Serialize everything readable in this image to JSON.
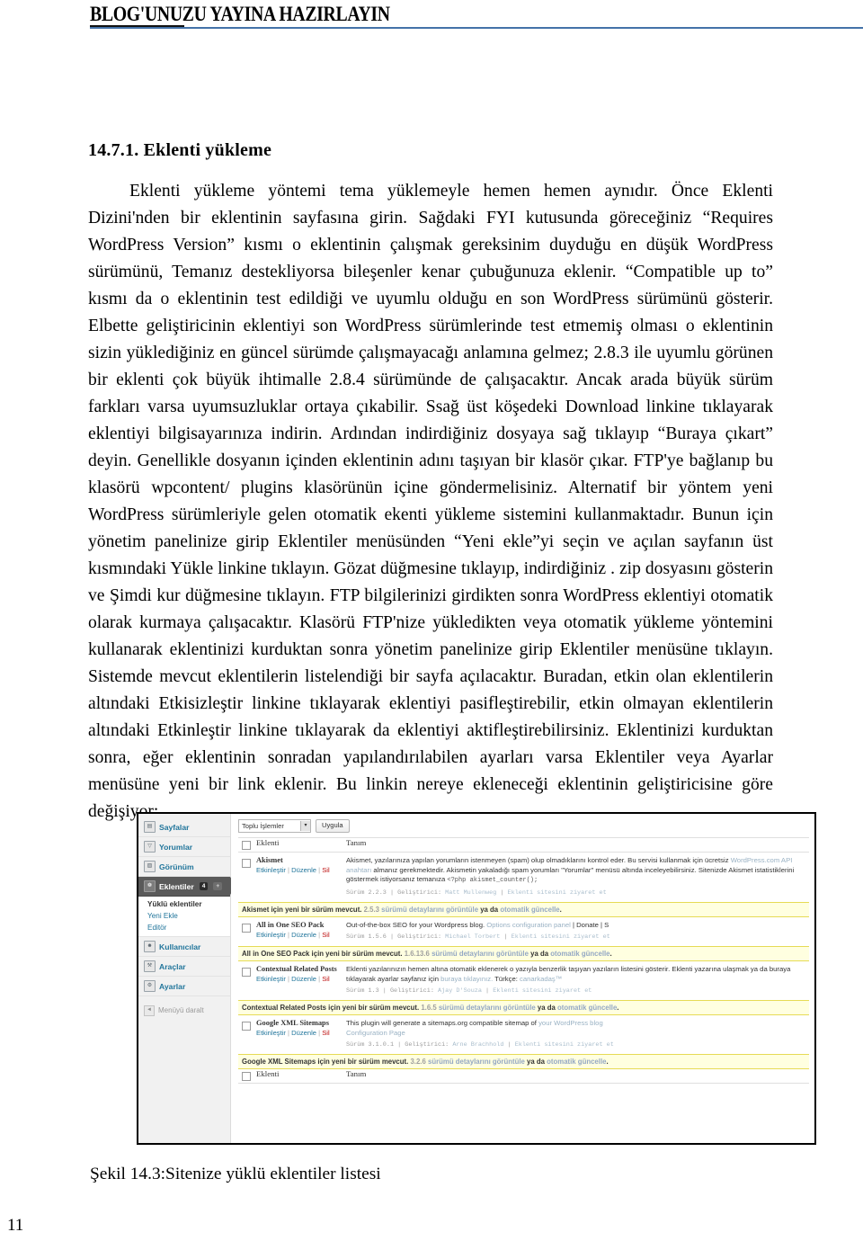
{
  "running_head": {
    "title": "BLOG'UNUZU YAYINA HAZIRLAYIN",
    "rule_color": "#4472a8"
  },
  "section": {
    "heading": "14.7.1. Eklenti yükleme",
    "body": "Eklenti yükleme yöntemi tema yüklemeyle hemen hemen aynıdır. Önce Eklenti Dizini'nden bir eklentinin sayfasına girin. Sağdaki FYI kutusunda göreceğiniz “Requires WordPress Version” kısmı o eklentinin çalışmak gereksinim duyduğu en düşük WordPress sürümünü, Temanız destekliyorsa bileşenler kenar çubuğunuza eklenir. “Compatible up to” kısmı da o eklentinin test edildiği ve uyumlu olduğu en son WordPress sürümünü gösterir. Elbette geliştiricinin eklentiyi son WordPress sürümlerinde test etmemiş olması o eklentinin sizin yüklediğiniz en güncel sürümde çalışmayacağı anlamına gelmez; 2.8.3 ile uyumlu görünen bir eklenti çok büyük ihtimalle 2.8.4 sürümünde de çalışacaktır. Ancak arada büyük sürüm farkları varsa uyumsuzluklar ortaya çıkabilir. Ssağ üst köşedeki Download linkine tıklayarak eklentiyi bilgisayarınıza indirin. Ardından indirdiğiniz dosyaya sağ tıklayıp “Buraya çıkart” deyin. Genellikle dosyanın içinden eklentinin adını taşıyan bir klasör çıkar. FTP'ye bağlanıp bu klasörü wpcontent/ plugins klasörünün içine göndermelisiniz. Alternatif bir yöntem yeni WordPress sürümleriyle gelen otomatik ekenti yükleme sistemini kullanmaktadır. Bunun için yönetim panelinize girip Eklentiler menüsünden “Yeni ekle”yi seçin ve açılan sayfanın üst kısmındaki Yükle linkine tıklayın. Gözat düğmesine tıklayıp, indirdiğiniz . zip dosyasını gösterin ve Şimdi kur düğmesine tıklayın. FTP bilgilerinizi girdikten sonra WordPress eklentiyi otomatik olarak kurmaya çalışacaktır. Klasörü FTP'nize yükledikten veya otomatik yükleme yöntemini kullanarak eklentinizi kurduktan sonra yönetim panelinize girip Eklentiler menüsüne tıklayın. Sistemde mevcut eklentilerin listelendiği bir sayfa açılacaktır. Buradan, etkin olan eklentilerin altındaki Etkisizleştir linkine tıklayarak eklentiyi pasifleştirebilir, etkin olmayan eklentilerin altındaki Etkinleştir linkine tıklayarak da eklentiyi aktifleştirebilirsiniz. Eklentinizi kurduktan sonra, eğer eklentinin sonradan yapılandırılabilen ayarları varsa Eklentiler veya Ayarlar menüsüne yeni bir link eklenir. Bu linkin nereye ekleneceği eklentinin geliştiricisine göre değişiyor;"
  },
  "figure": {
    "caption": "Şekil 14.3:Sitenize yüklü eklentiler listesi",
    "sidebar": {
      "items": [
        {
          "label": "Sayfalar",
          "icon": "page-icon",
          "glyph": "▤"
        },
        {
          "label": "Yorumlar",
          "icon": "comment-icon",
          "glyph": "▽"
        },
        {
          "label": "Görünüm",
          "icon": "appearance-icon",
          "glyph": "▨"
        }
      ],
      "active": {
        "label": "Eklentiler",
        "icon": "plugin-icon",
        "glyph": "❁",
        "badge": "4",
        "badge_plus": "+"
      },
      "submenu": [
        {
          "label": "Yüklü eklentiler",
          "current": true
        },
        {
          "label": "Yeni Ekle",
          "current": false
        },
        {
          "label": "Editör",
          "current": false
        }
      ],
      "items_after": [
        {
          "label": "Kullanıcılar",
          "icon": "users-icon",
          "glyph": "☻"
        },
        {
          "label": "Araçlar",
          "icon": "tools-icon",
          "glyph": "⚒"
        },
        {
          "label": "Ayarlar",
          "icon": "settings-icon",
          "glyph": "⚙"
        }
      ],
      "collapse": {
        "label": "Menüyü daralt",
        "glyph": "◄"
      }
    },
    "toolbar": {
      "bulk_select_value": "Toplu İşlemler",
      "bulk_select_arrow": "▾",
      "apply_button": "Uygula"
    },
    "table": {
      "headers": {
        "name": "Eklenti",
        "description": "Tanım"
      },
      "rows": [
        {
          "name": "Akismet",
          "actions": {
            "activate": "Etkinleştir",
            "edit": "Düzenle",
            "delete": "Sil"
          },
          "description_1": "Akismet, yazılarınıza yapılan yorumların istenmeyen (spam) olup olmadıklarını kontrol eder. Bu servisi kullanmak için ücretsiz ",
          "description_link": "WordPress.com API anahtarı",
          "description_2": " almanız gerekmektedir. Akismetin yakaladığı spam yorumları \"Yorumlar\" menüsü altında inceleyebilirsiniz. Sitenizde Akismet istatistiklerini göstermek istiyorsanız temanıza ",
          "description_code": "<?php akismet_counter();",
          "meta_version": "Sürüm 2.2.3",
          "meta_author_label": "Geliştirici:",
          "meta_author": "Matt Mullenweg",
          "meta_site": "Eklenti sitesini ziyaret et",
          "update_prefix": "Akismet için yeni bir sürüm mevcut.",
          "update_version": "2.5.3",
          "update_link1": "sürümü detaylarını görüntüle",
          "update_mid": "ya da",
          "update_link2": "otomatik güncelle",
          "update_suffix": "."
        },
        {
          "name": "All in One SEO Pack",
          "actions": {
            "activate": "Etkinleştir",
            "edit": "Düzenle",
            "delete": "Sil"
          },
          "description_1": "Out-of-the-box SEO for your Wordpress blog. ",
          "description_link": "Options configuration panel",
          "description_2": " | Donate | S",
          "description_code": "",
          "meta_version": "Sürüm 1.5.6",
          "meta_author_label": "Geliştirici:",
          "meta_author": "Michael Torbert",
          "meta_site": "Eklenti sitesini ziyaret et",
          "update_prefix": "All in One SEO Pack için yeni bir sürüm mevcut.",
          "update_version": "1.6.13.6",
          "update_link1": "sürümü detaylarını görüntüle",
          "update_mid": "ya da",
          "update_link2": "otomatik güncelle",
          "update_suffix": "."
        },
        {
          "name": "Contextual Related Posts",
          "actions": {
            "activate": "Etkinleştir",
            "edit": "Düzenle",
            "delete": "Sil"
          },
          "description_1": "Eklenti yazılarınızın hemen altına otomatik eklenerek o yazıyla benzerlik taşıyan yazıların listesini gösterir. Eklenti yazarına ulaşmak ya da buraya tıklayarak ayarlar sayfanız için ",
          "description_link": "buraya tıklayınız.",
          "description_2": " Türkçe: ",
          "description_code": "canarkadaş™",
          "meta_version": "Sürüm 1.3",
          "meta_author_label": "Geliştirici:",
          "meta_author": "Ajay D'Souza",
          "meta_site": "Eklenti sitesini ziyaret et",
          "update_prefix": "Contextual Related Posts için yeni bir sürüm mevcut.",
          "update_version": "1.6.5",
          "update_link1": "sürümü detaylarını görüntüle",
          "update_mid": "ya da",
          "update_link2": "otomatik güncelle",
          "update_suffix": "."
        },
        {
          "name": "Google XML  Sitemaps",
          "actions": {
            "activate": "Etkinleştir",
            "edit": "Düzenle",
            "delete": "Sil"
          },
          "description_1": "This plugin will generate a sitemaps.org compatible sitemap of ",
          "description_link": "your WordPress blog",
          "description_2": " ",
          "description_code": "Configuration Page",
          "meta_version": "Sürüm 3.1.0.1",
          "meta_author_label": "Geliştirici:",
          "meta_author": "Arne Brachhold",
          "meta_site": "Eklenti sitesini ziyaret et",
          "update_prefix": "Google XML  Sitemaps için yeni bir sürüm mevcut.",
          "update_version": "3.2.6",
          "update_link1": "sürümü detaylarını görüntüle",
          "update_mid": "ya da",
          "update_link2": "otomatik güncelle",
          "update_suffix": "."
        }
      ],
      "footers": {
        "name": "Eklenti",
        "description": "Tanım"
      }
    }
  },
  "folio": "11"
}
